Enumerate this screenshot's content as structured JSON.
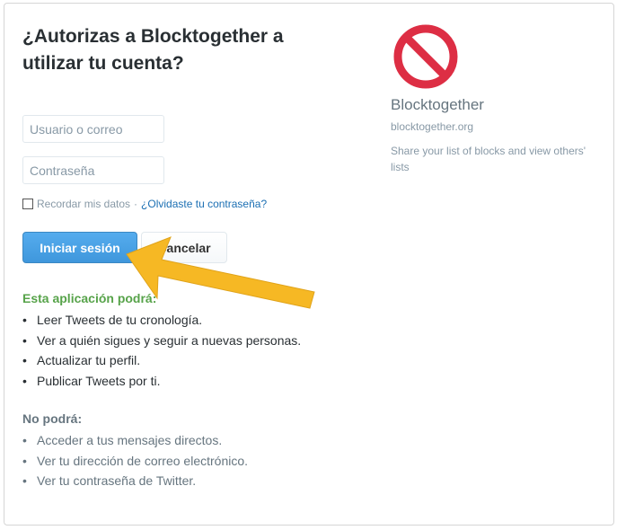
{
  "title": "¿Autorizas a Blocktogether a utilizar tu cuenta?",
  "form": {
    "username_placeholder": "Usuario o correo",
    "password_placeholder": "Contraseña",
    "remember_label": "Recordar mis datos",
    "separator": "·",
    "forgot_link": "¿Olvidaste tu contraseña?",
    "signin_button": "Iniciar sesión",
    "cancel_button": "Cancelar"
  },
  "permissions": {
    "can_title": "Esta aplicación podrá:",
    "can_items": [
      "Leer Tweets de tu cronología.",
      "Ver a quién sigues y seguir a nuevas personas.",
      "Actualizar tu perfil.",
      "Publicar Tweets por ti."
    ],
    "cannot_title": "No podrá:",
    "cannot_items": [
      "Acceder a tus mensajes directos.",
      "Ver tu dirección de correo electrónico.",
      "Ver tu contraseña de Twitter."
    ]
  },
  "app": {
    "name": "Blocktogether",
    "url": "blocktogether.org",
    "description": "Share your list of blocks and view others' lists",
    "logo_icon": "prohibited-icon",
    "logo_color": "#dd2e44"
  },
  "annotation": {
    "arrow_color": "#f6b824",
    "arrow_icon": "pointer-arrow-icon"
  }
}
